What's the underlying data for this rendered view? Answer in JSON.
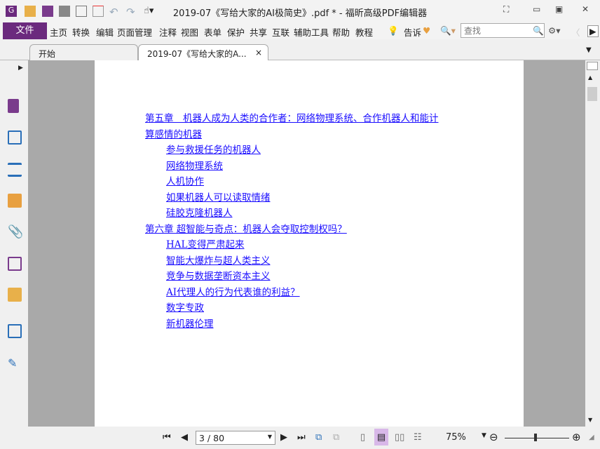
{
  "window": {
    "title": "2019-07《写给大家的AI极简史》.pdf * - 福昕高级PDF编辑器"
  },
  "menu": {
    "file": "文件",
    "items": [
      "主页",
      "转换",
      "编辑",
      "页面管理",
      "注释",
      "视图",
      "表单",
      "保护",
      "共享",
      "互联",
      "辅助工具",
      "帮助",
      "教程"
    ],
    "tell": "告诉",
    "search_placeholder": "查找"
  },
  "tabs": [
    {
      "label": "开始"
    },
    {
      "label": "2019-07《写给大家的A...",
      "close": "×"
    }
  ],
  "toc": [
    {
      "text": "第五章　机器人成为人类的合作者：网络物理系统、合作机器人和能计",
      "level": 0
    },
    {
      "text": "算感情的机器",
      "level": 0
    },
    {
      "text": "参与救援任务的机器人",
      "level": 1
    },
    {
      "text": "网络物理系统",
      "level": 1
    },
    {
      "text": "人机协作",
      "level": 1
    },
    {
      "text": "如果机器人可以读取情绪",
      "level": 1
    },
    {
      "text": "硅胶克隆机器人",
      "level": 1
    },
    {
      "text": "第六章 超智能与奇点：机器人会夺取控制权吗？",
      "level": 0
    },
    {
      "text": "HAL变得严肃起来",
      "level": 1
    },
    {
      "text": "智能大爆炸与超人类主义",
      "level": 1
    },
    {
      "text": "竞争与数据垄断资本主义",
      "level": 1
    },
    {
      "text": "AI代理人的行为代表谁的利益？",
      "level": 1
    },
    {
      "text": "数字专政",
      "level": 1
    },
    {
      "text": "新机器伦理",
      "level": 1
    }
  ],
  "status": {
    "page": "3 / 80",
    "zoom": "75%",
    "zoom_fraction": 0.5
  },
  "colors": {
    "accent": "#6b2a7e",
    "link": "#1a0dff",
    "viewer_bg": "#a9a9a9"
  }
}
